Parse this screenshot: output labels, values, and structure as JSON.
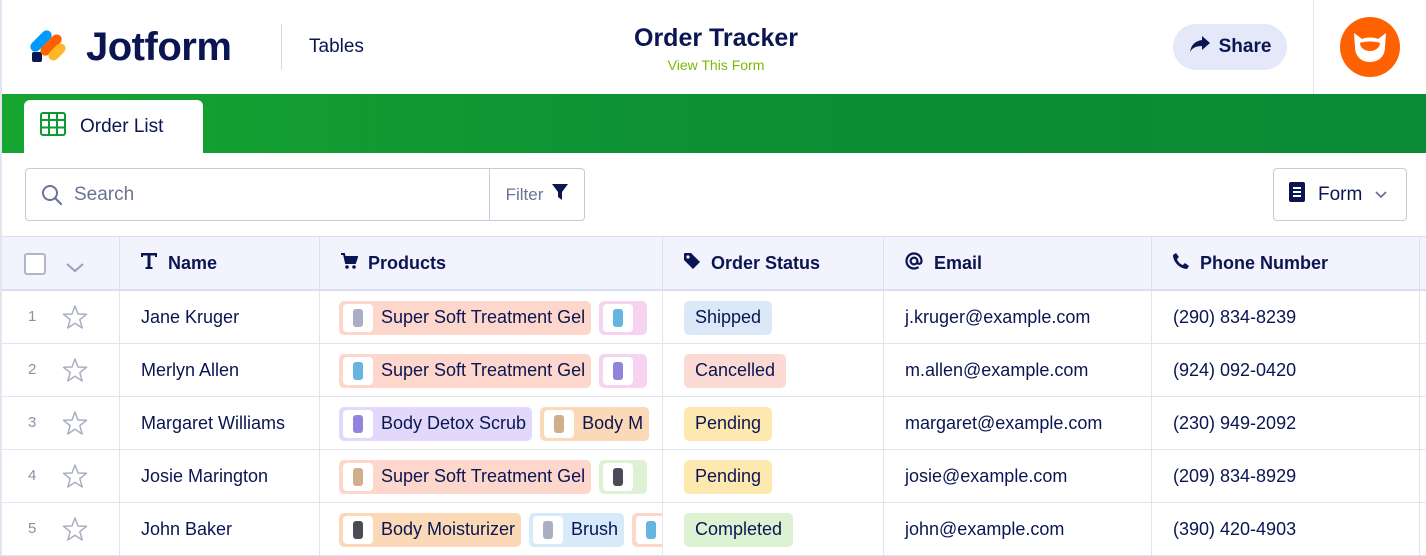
{
  "header": {
    "logo_text": "Jotform",
    "section": "Tables",
    "title": "Order Tracker",
    "view_form": "View This Form",
    "share_label": "Share",
    "avatar_color": "#ff6100"
  },
  "tab": {
    "label": "Order List",
    "icon": "grid-table-icon"
  },
  "toolbar": {
    "search_placeholder": "Search",
    "filter_label": "Filter",
    "form_label": "Form"
  },
  "columns": [
    {
      "label": "Name",
      "icon": "text-type-icon"
    },
    {
      "label": "Products",
      "icon": "cart-icon"
    },
    {
      "label": "Order Status",
      "icon": "tag-icon"
    },
    {
      "label": "Email",
      "icon": "at-icon"
    },
    {
      "label": "Phone Number",
      "icon": "phone-icon"
    }
  ],
  "rows": [
    {
      "num": "1",
      "name": "Jane Kruger",
      "products": [
        {
          "label": "Super Soft Treatment Gel",
          "color": "#fdd6cc"
        },
        {
          "label": "",
          "color": "#f6d3f0"
        }
      ],
      "status": "Shipped",
      "status_color": "#dbe8f8",
      "email": "j.kruger@example.com",
      "phone": "(290) 834-8239"
    },
    {
      "num": "2",
      "name": "Merlyn Allen",
      "products": [
        {
          "label": "Super Soft Treatment Gel",
          "color": "#fdd6cc"
        },
        {
          "label": "",
          "color": "#f6d3f0"
        }
      ],
      "status": "Cancelled",
      "status_color": "#fbdad3",
      "email": "m.allen@example.com",
      "phone": "(924) 092-0420"
    },
    {
      "num": "3",
      "name": "Margaret Williams",
      "products": [
        {
          "label": "Body Detox Scrub",
          "color": "#e2d8fb"
        },
        {
          "label": "Body M",
          "color": "#fbd8b6"
        }
      ],
      "status": "Pending",
      "status_color": "#fde9b0",
      "email": "margaret@example.com",
      "phone": "(230) 949-2092"
    },
    {
      "num": "4",
      "name": "Josie Marington",
      "products": [
        {
          "label": "Super Soft Treatment Gel",
          "color": "#fdd6cc"
        },
        {
          "label": "",
          "color": "#dcf2d2"
        }
      ],
      "status": "Pending",
      "status_color": "#fde9b0",
      "email": "josie@example.com",
      "phone": "(209) 834-8929"
    },
    {
      "num": "5",
      "name": "John Baker",
      "products": [
        {
          "label": "Body Moisturizer",
          "color": "#fbd8b6"
        },
        {
          "label": "Brush",
          "color": "#d6eaf9"
        },
        {
          "label": "",
          "color": "#fdd6cc"
        }
      ],
      "status": "Completed",
      "status_color": "#dcf2d2",
      "email": "john@example.com",
      "phone": "(390) 420-4903"
    }
  ]
}
